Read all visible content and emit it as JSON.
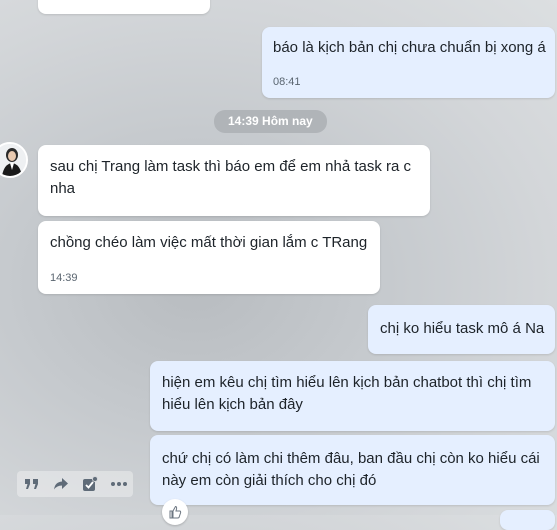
{
  "separator": {
    "label": "14:39 Hôm nay"
  },
  "messages": [
    {
      "text": "báo là kịch bản chị chưa chuẩn bị xong á",
      "time": "08:41"
    },
    {
      "text": "sau chị Trang làm task thì báo em để em  nhả task ra c nha"
    },
    {
      "text": "chồng chéo làm việc mất thời gian lắm c TRang",
      "time": "14:39"
    },
    {
      "text": "chị ko hiểu task mô á Na"
    },
    {
      "text": "hiện em kêu chị tìm hiểu lên kịch bản chatbot thì chị tìm hiểu lên kịch bản đây"
    },
    {
      "text": "chứ chị có làm chi thêm đâu, ban đầu chị còn ko hiểu cái này em còn giải thích cho chị đó"
    }
  ],
  "toolbar": {
    "icons": [
      "quote-icon",
      "forward-icon",
      "select-icon",
      "more-icon"
    ]
  },
  "colors": {
    "incoming_bubble": "#ffffff",
    "outgoing_bubble": "#e5efff",
    "separator_bg": "#b0b4b8"
  }
}
